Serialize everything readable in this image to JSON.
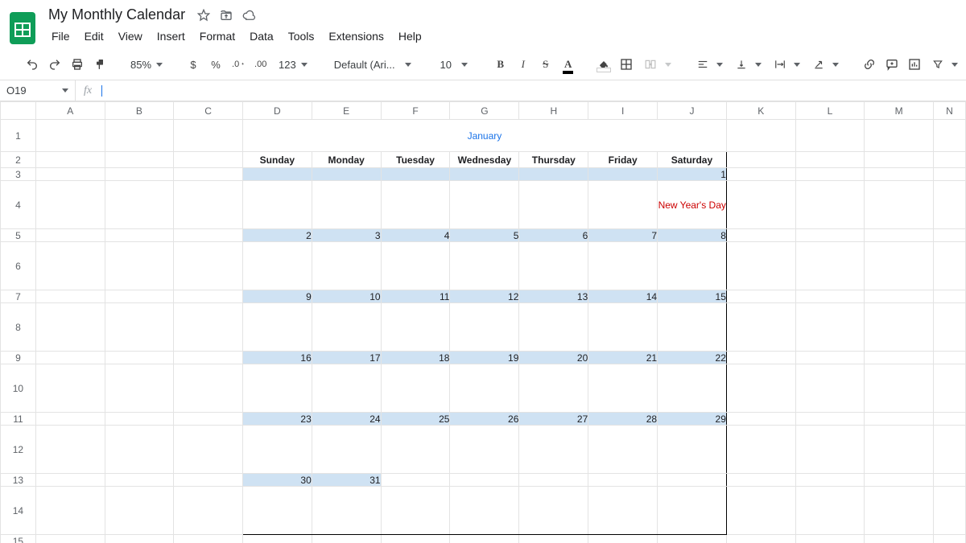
{
  "doc": {
    "title": "My Monthly Calendar"
  },
  "menu": {
    "file": "File",
    "edit": "Edit",
    "view": "View",
    "insert": "Insert",
    "format": "Format",
    "data": "Data",
    "tools": "Tools",
    "extensions": "Extensions",
    "help": "Help"
  },
  "toolbar": {
    "zoom": "85%",
    "currency": "$",
    "percent": "%",
    "dec_dec": ".0",
    "inc_dec": ".00",
    "more_fmt": "123",
    "font": "Default (Ari...",
    "size": "10",
    "bold": "B",
    "italic": "I",
    "strike": "S",
    "textcolor": "A"
  },
  "namebox": "O19",
  "columns": [
    "A",
    "B",
    "C",
    "D",
    "E",
    "F",
    "G",
    "H",
    "I",
    "J",
    "K",
    "L",
    "M",
    "N"
  ],
  "rows": [
    "1",
    "2",
    "3",
    "4",
    "5",
    "6",
    "7",
    "8",
    "9",
    "10",
    "11",
    "12",
    "13",
    "14",
    "15"
  ],
  "calendar": {
    "month": "January",
    "days_of_week": [
      "Sunday",
      "Monday",
      "Tuesday",
      "Wednesday",
      "Thursday",
      "Friday",
      "Saturday"
    ],
    "weeks": [
      {
        "nums": [
          "",
          "",
          "",
          "",
          "",
          "",
          "1"
        ],
        "notes": [
          "",
          "",
          "",
          "",
          "",
          "",
          "New Year's Day"
        ]
      },
      {
        "nums": [
          "2",
          "3",
          "4",
          "5",
          "6",
          "7",
          "8"
        ],
        "notes": [
          "",
          "",
          "",
          "",
          "",
          "",
          ""
        ]
      },
      {
        "nums": [
          "9",
          "10",
          "11",
          "12",
          "13",
          "14",
          "15"
        ],
        "notes": [
          "",
          "",
          "",
          "",
          "",
          "",
          ""
        ]
      },
      {
        "nums": [
          "16",
          "17",
          "18",
          "19",
          "20",
          "21",
          "22"
        ],
        "notes": [
          "",
          "",
          "",
          "",
          "",
          "",
          ""
        ]
      },
      {
        "nums": [
          "23",
          "24",
          "25",
          "26",
          "27",
          "28",
          "29"
        ],
        "notes": [
          "",
          "",
          "",
          "",
          "",
          "",
          ""
        ]
      },
      {
        "nums": [
          "30",
          "31",
          "",
          "",
          "",
          "",
          ""
        ],
        "notes": [
          "",
          "",
          "",
          "",
          "",
          "",
          ""
        ]
      }
    ]
  }
}
